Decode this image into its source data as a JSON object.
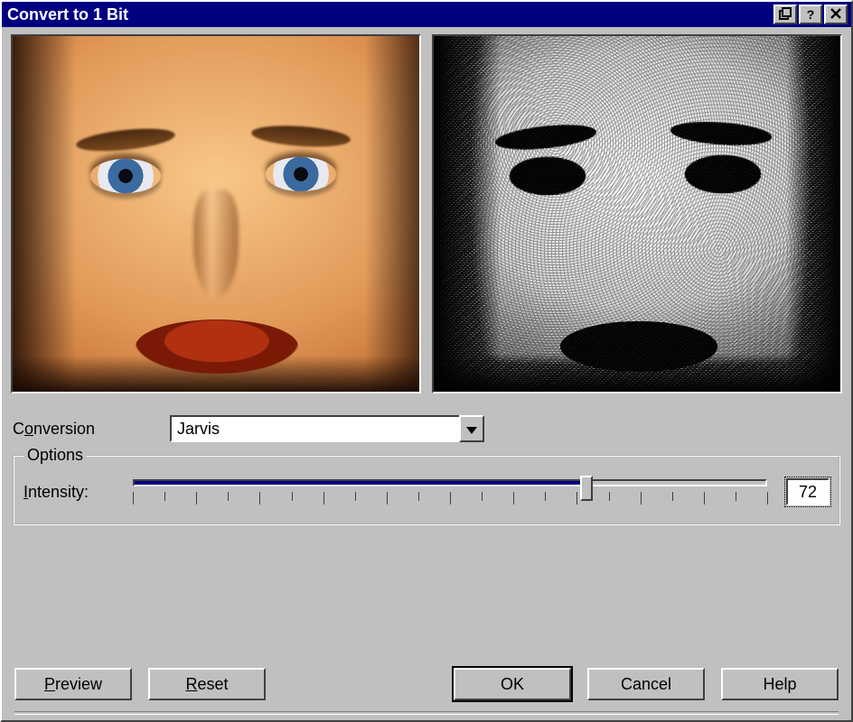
{
  "window": {
    "title": "Convert to 1 Bit"
  },
  "preview": {
    "left_kind": "original-color-image",
    "right_kind": "dithered-1bit-image"
  },
  "conversion": {
    "label_pre": "C",
    "label_ul": "o",
    "label_post": "nversion",
    "selected": "Jarvis"
  },
  "options": {
    "legend": "Options",
    "intensity": {
      "label_ul": "I",
      "label_post": "ntensity:",
      "value": "72",
      "min": 0,
      "max": 100,
      "percent": 72
    }
  },
  "buttons": {
    "preview": {
      "ul": "P",
      "rest": "review"
    },
    "reset": {
      "ul": "R",
      "rest": "eset"
    },
    "ok": "OK",
    "cancel": "Cancel",
    "help": "Help"
  }
}
